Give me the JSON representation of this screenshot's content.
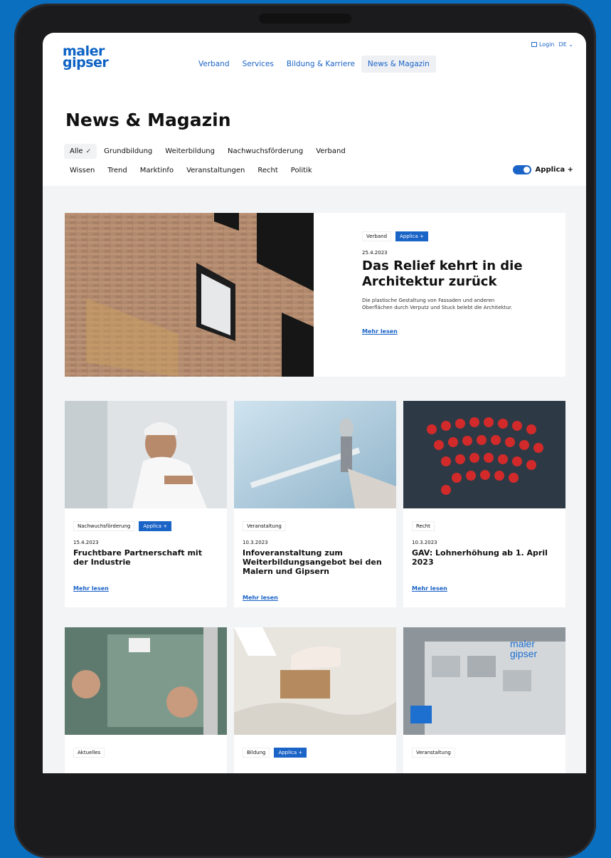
{
  "header": {
    "logo_line1": "maler",
    "logo_line2": "gipser",
    "nav": [
      "Verband",
      "Services",
      "Bildung & Karriere",
      "News & Magazin"
    ],
    "login": "Login",
    "language": "DE"
  },
  "page_title": "News & Magazin",
  "filters": {
    "row1": [
      "Alle",
      "Grundbildung",
      "Weiterbildung",
      "Nachwuchsförderung",
      "Verband"
    ],
    "row2": [
      "Wissen",
      "Trend",
      "Marktinfo",
      "Veranstaltungen",
      "Recht",
      "Politik"
    ],
    "selected_check": "✓",
    "toggle_label": "Applica +"
  },
  "featured": {
    "tag": "Verband",
    "badge": "Applica +",
    "date": "25.4.2023",
    "title": "Das Relief kehrt in die Architektur zurück",
    "description": "Die plastische Gestaltung von Fassaden und anderen Oberflächen durch Verputz und Stuck belebt die Architektur.",
    "link": "Mehr lesen"
  },
  "cards_row1": [
    {
      "tag": "Nachwuchsförderung",
      "badge": "Applica +",
      "date": "15.4.2023",
      "title": "Fruchtbare Partnerschaft mit der Industrie",
      "link": "Mehr lesen"
    },
    {
      "tag": "Veranstaltung",
      "badge": "",
      "date": "10.3.2023",
      "title": "Infoveranstaltung zum Weiterbildungsangebot bei den Malern und Gipsern",
      "link": "Mehr lesen"
    },
    {
      "tag": "Recht",
      "badge": "",
      "date": "10.3.2023",
      "title": "GAV: Lohnerhöhung ab 1. April 2023",
      "link": "Mehr lesen"
    }
  ],
  "cards_row2": [
    {
      "tag": "Aktuelles",
      "badge": ""
    },
    {
      "tag": "Bildung",
      "badge": "Applica +"
    },
    {
      "tag": "Veranstaltung",
      "badge": ""
    }
  ],
  "booth_logo_line1": "maler",
  "booth_logo_line2": "gipser"
}
